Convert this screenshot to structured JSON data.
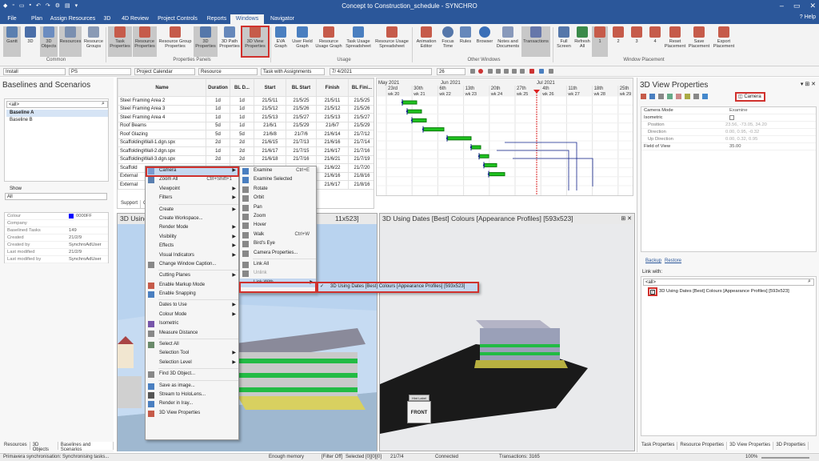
{
  "window": {
    "title": "Concept to Construction_schedule - SYNCHRO",
    "min": "–",
    "max": "▭",
    "close": "✕"
  },
  "menu_tabs": [
    "File",
    "Plan",
    "Assign Resources",
    "3D",
    "4D Review",
    "Project Controls",
    "Reports",
    "Windows",
    "Navigator"
  ],
  "active_tab": "Windows",
  "help": "Help",
  "ribbon": {
    "buttons": [
      "Gantt",
      "3D",
      "3D Objects",
      "Resources",
      "Resource Groups",
      "Task Properties",
      "Resource Properties",
      "Resource Group Properties",
      "3D Properties",
      "3D Path Properties",
      "3D View Properties",
      "EVA Graph",
      "User Field Graph",
      "Resource Usage Graph",
      "Task Usage Spreadsheet",
      "Resource Usage Spreadsheet",
      "Animation Editor",
      "Focus Time",
      "Rules",
      "Browser",
      "Notes and Documents",
      "Transactions",
      "Full Screen",
      "Refresh All",
      "1",
      "2",
      "3",
      "4",
      "Reset Placement",
      "Save Placement",
      "Export Placement"
    ],
    "groups": [
      "Common",
      "Properties Panels",
      "Usage",
      "Other Windows",
      "Window Placement"
    ]
  },
  "toolbar2": {
    "combo1": "Install",
    "combo2": "PS",
    "combo3": "Project Calendar",
    "combo4": "Resource",
    "combo5": "Task with Assignments",
    "date": "7/ 4/2021",
    "zoom": "26"
  },
  "left_panel": {
    "title": "Baselines and Scenarios",
    "search_value": "<all>",
    "baselines": [
      "Baseline A",
      "Baseline B"
    ],
    "show_label": "Show",
    "show_value": "All",
    "props": [
      {
        "k": "Colour",
        "v": "0000FF"
      },
      {
        "k": "Company",
        "v": ""
      },
      {
        "k": "Baselined Tasks",
        "v": "149"
      },
      {
        "k": "Created",
        "v": "21/2/9"
      },
      {
        "k": "Created by",
        "v": "SynchroAdUser"
      },
      {
        "k": "Last modified",
        "v": "21/2/9"
      },
      {
        "k": "Last modified by",
        "v": "SynchroAdUser"
      }
    ],
    "tabs": [
      "Resources",
      "3D Objects",
      "Baselines and Scenarios"
    ]
  },
  "gantt": {
    "headers": [
      "Name",
      "Duration",
      "BL D...",
      "Start",
      "BL Start",
      "Finish",
      "BL Fini..."
    ],
    "rows": [
      [
        "Steel Framing Area 2",
        "1d",
        "1d",
        "21/5/11",
        "21/5/25",
        "21/5/11",
        "21/5/25"
      ],
      [
        "Steel Framing Area 3",
        "1d",
        "1d",
        "21/5/12",
        "21/5/26",
        "21/5/12",
        "21/5/26"
      ],
      [
        "Steel Framing Area 4",
        "1d",
        "1d",
        "21/5/13",
        "21/5/27",
        "21/5/13",
        "21/5/27"
      ],
      [
        "Roof Beams",
        "5d",
        "1d",
        "21/6/1",
        "21/5/29",
        "21/6/7",
        "21/5/29"
      ],
      [
        "Roof Glazing",
        "5d",
        "5d",
        "21/6/8",
        "21/7/6",
        "21/6/14",
        "21/7/12"
      ],
      [
        "ScaffoldingWall-1.dgn.spx",
        "2d",
        "2d",
        "21/6/15",
        "21/7/13",
        "21/6/16",
        "21/7/14"
      ],
      [
        "ScaffoldingWall-2.dgn.spx",
        "1d",
        "2d",
        "21/6/17",
        "21/7/15",
        "21/6/17",
        "21/7/16"
      ],
      [
        "ScaffoldingWall-3.dgn.spx",
        "2d",
        "2d",
        "21/6/18",
        "21/7/16",
        "21/6/21",
        "21/7/19"
      ],
      [
        "Scaffold",
        "",
        "",
        "",
        "",
        "21/6/22",
        "21/7/20"
      ],
      [
        "External",
        "",
        "",
        "",
        "",
        "21/6/16",
        "21/8/16"
      ],
      [
        "External",
        "",
        "",
        "",
        "",
        "21/6/17",
        "21/8/16"
      ]
    ],
    "months": [
      "May 2021",
      "Jun 2021",
      "Jul 2021"
    ],
    "weeks": [
      "23rd",
      "30th",
      "6th",
      "13th",
      "20th",
      "27th",
      "4th",
      "11th",
      "18th",
      "25th"
    ],
    "wks": [
      "wk 20",
      "wk 21",
      "wk 22",
      "wk 23",
      "wk 24",
      "wk 25",
      "wk 26",
      "wk 27",
      "wk 28",
      "wk 29"
    ],
    "bottom_tabs": [
      "Support",
      "Gantt"
    ]
  },
  "context_menu": {
    "items": [
      "Camera",
      "Zoom All",
      "Viewpoint",
      "Filters",
      "Create",
      "Create Workspace...",
      "Render Mode",
      "Visibility",
      "Effects",
      "Visual Indicators",
      "Change Window Caption...",
      "Cutting Planes",
      "Enable Markup Mode",
      "Enable Snapping",
      "Dates to Use",
      "Colour Mode",
      "Isometric",
      "Measure Distance",
      "Select All",
      "Selection Tool",
      "Selection Level",
      "Find 3D Object...",
      "Save as image...",
      "Stream to HoloLens...",
      "Render in Iray...",
      "3D View Properties"
    ],
    "zoom_shortcut": "Ctrl+Shift+1"
  },
  "camera_submenu": {
    "items": [
      "Examine",
      "Examine Selected",
      "Rotate",
      "Orbit",
      "Pan",
      "Zoom",
      "Hover",
      "Walk",
      "Bird's Eye",
      "Camera Properties...",
      "Link All",
      "Unlink",
      "Link With"
    ],
    "examine_shortcut": "Ctrl+E",
    "walk_shortcut": "Ctrl+W"
  },
  "link_submenu": {
    "item": "3D Using Dates [Best] Colours [Appearance Profiles]  [593x523]"
  },
  "view_left": {
    "title": "3D Using Dates [Best] Colours [Appearance Profiles]  [411x523]",
    "short_title": "3D Using",
    "tail": "11x523]"
  },
  "view_right": {
    "title": "3D Using Dates [Best] Colours [Appearance Profiles]  [593x523]",
    "viewcube_top": "Hint Label",
    "viewcube_front": "FRONT"
  },
  "right_panel": {
    "title": "3D View Properties",
    "camera_tab": "Camera",
    "props": [
      {
        "k": "Camera Mode",
        "v": "Examine"
      },
      {
        "k": "Isometric",
        "v": ""
      },
      {
        "k": "Position",
        "v": "23.56, -73.05, 34.20"
      },
      {
        "k": "Direction",
        "v": "0.00, 0.95, -0.32"
      },
      {
        "k": "Up Direction",
        "v": "0.00, 0.32, 0.95"
      },
      {
        "k": "Field of View",
        "v": "35.00"
      }
    ],
    "backup": "Backup",
    "restore": "Restore",
    "link_with_label": "Link with:",
    "search_value": "<all>",
    "link_item": "3D Using Dates [Best] Colours [Appearance Profiles]  [593x523]",
    "tabs": [
      "Task Properties",
      "Resource Properties",
      "3D View Properties",
      "3D Properties"
    ]
  },
  "statusbar": {
    "left": "Primavera synchronisation: Synchronising tasks...",
    "memory": "Enough memory",
    "filter": "[Filter Off]",
    "selected": "Selected [0][0][0]",
    "date": "21/7/4",
    "connected": "Connected",
    "transactions": "Transactions: 3165",
    "zoom": "100%"
  }
}
